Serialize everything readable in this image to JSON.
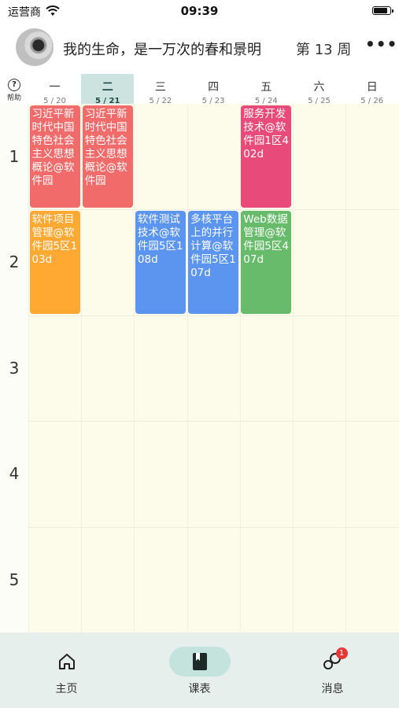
{
  "status_bar": {
    "carrier": "运营商",
    "time": "09:39"
  },
  "header": {
    "title": "我的生命，是一万次的春和景明",
    "week": "第 13 周",
    "more": "•••"
  },
  "help": {
    "label": "帮助"
  },
  "days": [
    {
      "name": "一",
      "date": "5 / 20",
      "today": false
    },
    {
      "name": "二",
      "date": "5 / 21",
      "today": true
    },
    {
      "name": "三",
      "date": "5 / 22",
      "today": false
    },
    {
      "name": "四",
      "date": "5 / 23",
      "today": false
    },
    {
      "name": "五",
      "date": "5 / 24",
      "today": false
    },
    {
      "name": "六",
      "date": "5 / 25",
      "today": false
    },
    {
      "name": "日",
      "date": "5 / 26",
      "today": false
    }
  ],
  "periods": [
    "1",
    "2",
    "3",
    "4",
    "5"
  ],
  "courses": [
    {
      "day": 1,
      "period": 1,
      "text": "习近平新时代中国特色社会主义思想概论@软件园",
      "color": "#f26b6b"
    },
    {
      "day": 2,
      "period": 1,
      "text": "习近平新时代中国特色社会主义思想概论@软件园",
      "color": "#f26b6b"
    },
    {
      "day": 5,
      "period": 1,
      "text": "服务开发技术@软件园1区402d",
      "color": "#e84b7a"
    },
    {
      "day": 1,
      "period": 2,
      "text": "软件项目管理@软件园5区103d",
      "color": "#ffa832"
    },
    {
      "day": 3,
      "period": 2,
      "text": "软件测试技术@软件园5区108d",
      "color": "#5b95f0"
    },
    {
      "day": 4,
      "period": 2,
      "text": "多核平台上的并行计算@软件园5区107d",
      "color": "#5b95f0"
    },
    {
      "day": 5,
      "period": 2,
      "text": "Web数据管理@软件园5区407d",
      "color": "#67bb6a"
    }
  ],
  "tabs": [
    {
      "label": "主页",
      "icon": "home-icon",
      "active": false
    },
    {
      "label": "课表",
      "icon": "book-icon",
      "active": true
    },
    {
      "label": "消息",
      "icon": "message-icon",
      "active": false,
      "badge": "1"
    }
  ],
  "colors": {
    "today_header": "#cde3df",
    "tab_active": "#c4e3dd",
    "tabbar_bg": "#e6efec",
    "badge": "#e53935"
  }
}
